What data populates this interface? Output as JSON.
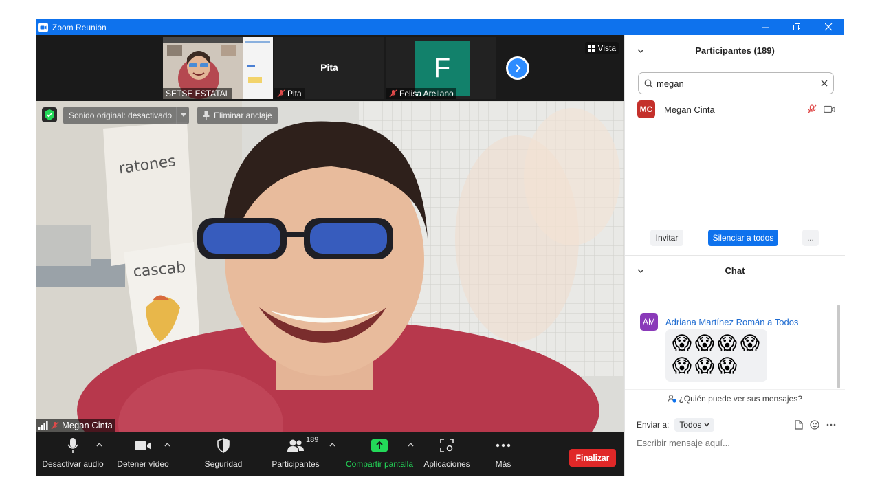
{
  "window": {
    "title": "Zoom Reunión",
    "brand_color": "#0e72ed"
  },
  "strip": {
    "thumbs": [
      {
        "name": "SETSE ESTATAL",
        "type": "video"
      },
      {
        "name": "Pita",
        "title": "Pita",
        "muted": true
      },
      {
        "name": "Felisa Arellano",
        "initial": "F",
        "muted": true,
        "avatar_color": "#12816b"
      }
    ],
    "view_label": "Vista"
  },
  "main": {
    "original_sound_label": "Sonido original: desactivado",
    "unpin_label": "Eliminar anclaje",
    "speaker_name": "Megan Cinta",
    "wall_words": [
      "ratones",
      "cascab"
    ]
  },
  "toolbar": {
    "mute_label": "Desactivar audio",
    "video_label": "Detener vídeo",
    "security_label": "Seguridad",
    "participants_label": "Participantes",
    "participants_count": "189",
    "share_label": "Compartir pantalla",
    "apps_label": "Aplicaciones",
    "more_label": "Más",
    "end_label": "Finalizar",
    "share_color": "#23d959",
    "end_color": "#e02828"
  },
  "participants": {
    "title": "Participantes (189)",
    "search_value": "megan",
    "list": [
      {
        "initials": "MC",
        "name": "Megan Cinta",
        "avatar_color": "#c4302b"
      }
    ],
    "invite_label": "Invitar",
    "mute_all_label": "Silenciar a todos",
    "more_label": "..."
  },
  "chat": {
    "title": "Chat",
    "messages": [
      {
        "initials": "AM",
        "sender": "Adriana Martínez Román a Todos",
        "emojis": [
          "😱",
          "😱",
          "😱",
          "😱",
          "😱",
          "😱",
          "😱"
        ],
        "avatar_color": "#8a3ab9"
      }
    ],
    "who_can_see": "¿Quién puede ver sus mensajes?",
    "send_to_label": "Enviar a:",
    "send_to_value": "Todos",
    "input_placeholder": "Escribir mensaje aquí..."
  }
}
